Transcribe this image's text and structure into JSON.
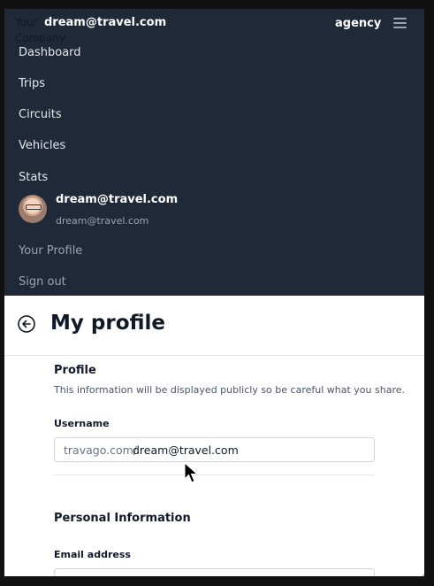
{
  "header": {
    "logo_text": "Your Company",
    "email": "dream@travel.com",
    "role": "agency",
    "menu_icon": "hamburger-icon"
  },
  "nav": {
    "items": [
      {
        "label": "Dashboard"
      },
      {
        "label": "Trips"
      },
      {
        "label": "Circuits"
      },
      {
        "label": "Vehicles"
      },
      {
        "label": "Stats"
      }
    ]
  },
  "user": {
    "name": "dream@travel.com",
    "email": "dream@travel.com",
    "menu": [
      {
        "label": "Your Profile"
      },
      {
        "label": "Sign out"
      }
    ]
  },
  "page": {
    "title": "My profile",
    "back_icon": "arrow-left-circle-icon"
  },
  "profile": {
    "section_title": "Profile",
    "description": "This information will be displayed publicly so be careful what you share.",
    "username_label": "Username",
    "username_prefix": "travago.com/",
    "username_value": "dream@travel.com"
  },
  "personal": {
    "section_title": "Personal Information",
    "email_label": "Email address"
  }
}
